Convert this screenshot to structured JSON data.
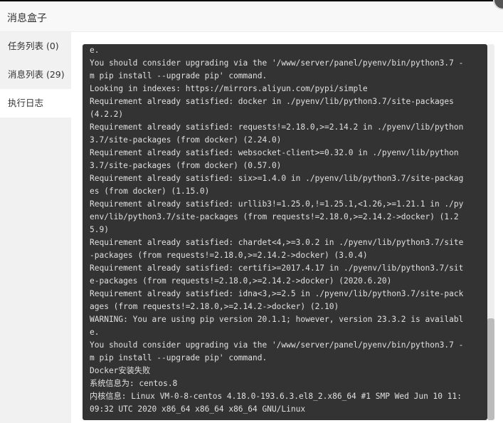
{
  "dialog": {
    "title": "消息盒子"
  },
  "sidebar": {
    "items": [
      {
        "label": "任务列表 (0)",
        "active": false
      },
      {
        "label": "消息列表 (29)",
        "active": false
      },
      {
        "label": "执行日志",
        "active": true
      }
    ]
  },
  "log": {
    "lines": [
      "e.",
      "You should consider upgrading via the '/www/server/panel/pyenv/bin/python3.7 -",
      "m pip install --upgrade pip' command.",
      "Looking in indexes: https://mirrors.aliyun.com/pypi/simple",
      "Requirement already satisfied: docker in ./pyenv/lib/python3.7/site-packages",
      "(4.2.2)",
      "Requirement already satisfied: requests!=2.18.0,>=2.14.2 in ./pyenv/lib/python",
      "3.7/site-packages (from docker) (2.24.0)",
      "Requirement already satisfied: websocket-client>=0.32.0 in ./pyenv/lib/python",
      "3.7/site-packages (from docker) (0.57.0)",
      "Requirement already satisfied: six>=1.4.0 in ./pyenv/lib/python3.7/site-packag",
      "es (from docker) (1.15.0)",
      "Requirement already satisfied: urllib3!=1.25.0,!=1.25.1,<1.26,>=1.21.1 in ./py",
      "env/lib/python3.7/site-packages (from requests!=2.18.0,>=2.14.2->docker) (1.2",
      "5.9)",
      "Requirement already satisfied: chardet<4,>=3.0.2 in ./pyenv/lib/python3.7/site",
      "-packages (from requests!=2.18.0,>=2.14.2->docker) (3.0.4)",
      "Requirement already satisfied: certifi>=2017.4.17 in ./pyenv/lib/python3.7/sit",
      "e-packages (from requests!=2.18.0,>=2.14.2->docker) (2020.6.20)",
      "Requirement already satisfied: idna<3,>=2.5 in ./pyenv/lib/python3.7/site-pack",
      "ages (from requests!=2.18.0,>=2.14.2->docker) (2.10)",
      "WARNING: You are using pip version 20.1.1; however, version 23.3.2 is availabl",
      "e.",
      "You should consider upgrading via the '/www/server/panel/pyenv/bin/python3.7 -",
      "m pip install --upgrade pip' command.",
      "Docker安装失败",
      "系统信息为: centos.8",
      "内核信息: Linux VM-0-8-centos 4.18.0-193.6.3.el8_2.x86_64 #1 SMP Wed Jun 10 11:",
      "09:32 UTC 2020 x86_64 x86_64 x86_64 GNU/Linux"
    ],
    "scroll_position_fraction": 0.73
  },
  "colors": {
    "log_background": "#333333",
    "log_text": "#e0e0e0",
    "sidebar_background": "#f1f1f1",
    "titlebar_background": "#f8f8f8"
  }
}
